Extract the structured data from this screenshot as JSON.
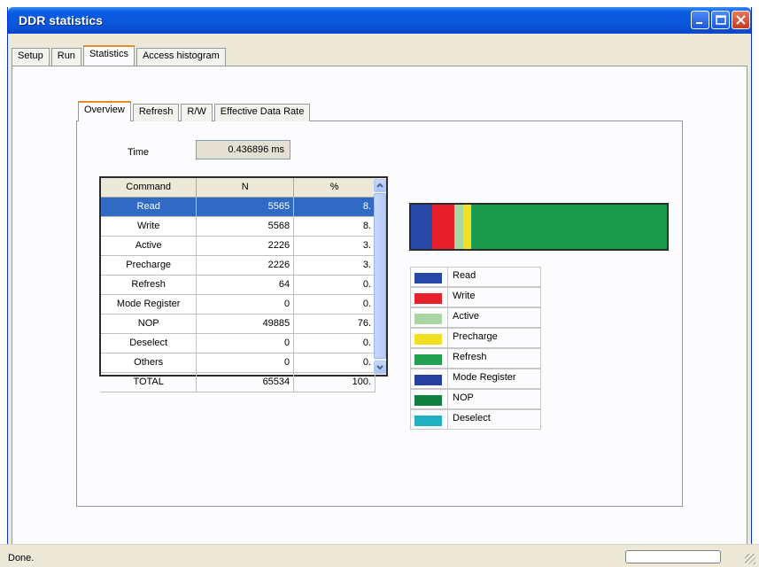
{
  "window": {
    "title": "DDR statistics"
  },
  "top_tabs": [
    {
      "label": "Setup",
      "active": false
    },
    {
      "label": "Run",
      "active": false
    },
    {
      "label": "Statistics",
      "active": true
    },
    {
      "label": "Access histogram",
      "active": false
    }
  ],
  "inner_tabs": [
    {
      "label": "Overview",
      "active": true
    },
    {
      "label": "Refresh",
      "active": false
    },
    {
      "label": "R/W",
      "active": false
    },
    {
      "label": "Effective Data Rate",
      "active": false
    }
  ],
  "time": {
    "label": "Time",
    "value": "0.436896 ms"
  },
  "table": {
    "headers": [
      "Command",
      "N",
      "%"
    ],
    "rows": [
      [
        "Read",
        "5565",
        "8."
      ],
      [
        "Write",
        "5568",
        "8."
      ],
      [
        "Active",
        "2226",
        "3."
      ],
      [
        "Precharge",
        "2226",
        "3."
      ],
      [
        "Refresh",
        "64",
        "0."
      ],
      [
        "Mode Register",
        "0",
        "0."
      ],
      [
        "NOP",
        "49885",
        "76."
      ],
      [
        "Deselect",
        "0",
        "0."
      ],
      [
        "Others",
        "0",
        "0."
      ],
      [
        "TOTAL",
        "65534",
        "100."
      ]
    ],
    "selected_row": 0
  },
  "bar_chart": {
    "segments": [
      {
        "name": "Read",
        "value": 5565,
        "color": "#2848a8"
      },
      {
        "name": "Write",
        "value": 5568,
        "color": "#e8202c"
      },
      {
        "name": "Active",
        "value": 2226,
        "color": "#a8d8a0"
      },
      {
        "name": "Precharge",
        "value": 2226,
        "color": "#f0e020"
      },
      {
        "name": "Refresh",
        "value": 64,
        "color": "#20a050"
      },
      {
        "name": "NOP",
        "value": 49885,
        "color": "#1a9a4c"
      }
    ]
  },
  "legend": [
    {
      "label": "Read",
      "color": "#2848a8"
    },
    {
      "label": "Write",
      "color": "#e8202c"
    },
    {
      "label": "Active",
      "color": "#a8d8a0"
    },
    {
      "label": "Precharge",
      "color": "#f0e020"
    },
    {
      "label": "Refresh",
      "color": "#20a050"
    },
    {
      "label": "Mode Register",
      "color": "#2840a0"
    },
    {
      "label": "NOP",
      "color": "#108040"
    },
    {
      "label": "Deselect",
      "color": "#20b0c0"
    }
  ],
  "status": {
    "text": "Done."
  }
}
